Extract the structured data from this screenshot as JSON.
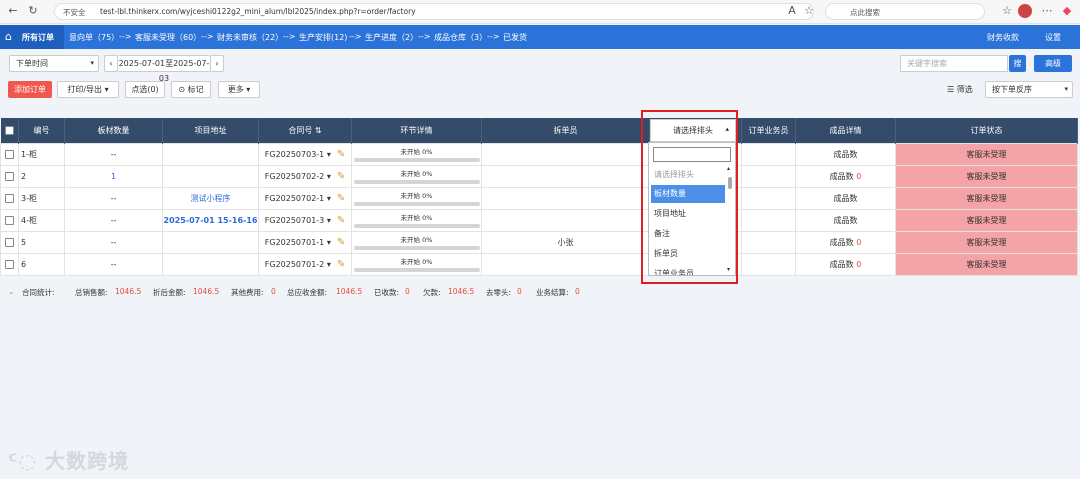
{
  "browser": {
    "insecure_label": "不安全",
    "url": "test-lbl.thinkerx.com/wyjceshi0122g2_mini_alum/lbl2025/index.php?r=order/factory",
    "search_placeholder": "点此搜索"
  },
  "nav": {
    "home_label": "所有订单",
    "tabs": [
      {
        "label": "意向单（75）"
      },
      {
        "label": "客服未受理（60）"
      },
      {
        "label": "财务未审核（22）"
      },
      {
        "label": "生产安排(12)"
      },
      {
        "label": "生产进度（2）"
      },
      {
        "label": "成品仓库（3）"
      },
      {
        "label": "已发货"
      }
    ],
    "arrow": "-->",
    "right": [
      "财务收款",
      "设置"
    ]
  },
  "filters": {
    "time_select": "下单时间",
    "date_range": "2025-07-01至2025-07-03",
    "keyword_placeholder": "关键字搜索",
    "search_button": "搜",
    "advanced_button": "高级"
  },
  "actions": {
    "add_order": "添加订单",
    "print_export": "打印/导出",
    "select": "点选(0)",
    "mark": "标记",
    "more": "更多",
    "filter": "筛选",
    "sort_select": "按下单反序"
  },
  "table": {
    "headers": [
      "编号",
      "板材数量",
      "项目地址",
      "合同号",
      "环节详情",
      "拆单员",
      "请选择排头",
      "订单业务员",
      "成品详情",
      "订单状态"
    ],
    "rows": [
      {
        "id": "1-柜",
        "qty": "--",
        "address": "",
        "contract": "FG20250703-1",
        "progress": "未开始 0%",
        "splitter": "",
        "product": "成品数",
        "product_count": "",
        "status": "客服未受理"
      },
      {
        "id": "2",
        "qty": "1",
        "address": "",
        "contract": "FG20250702-2",
        "progress": "未开始 0%",
        "splitter": "",
        "product": "成品数",
        "product_count": "0",
        "status": "客服未受理"
      },
      {
        "id": "3-柜",
        "qty": "--",
        "address": "测试小程序",
        "contract": "FG20250702-1",
        "progress": "未开始 0%",
        "splitter": "",
        "product": "成品数",
        "product_count": "",
        "status": "客服未受理"
      },
      {
        "id": "4-柜",
        "qty": "--",
        "address": "2025-07-01 15-16-16",
        "contract": "FG20250701-3",
        "progress": "未开始 0%",
        "splitter": "",
        "product": "成品数",
        "product_count": "",
        "status": "客服未受理"
      },
      {
        "id": "5",
        "qty": "--",
        "address": "",
        "contract": "FG20250701-1",
        "progress": "未开始 0%",
        "splitter": "小张",
        "product": "成品数",
        "product_count": "0",
        "status": "客服未受理"
      },
      {
        "id": "6",
        "qty": "--",
        "address": "",
        "contract": "FG20250701-2",
        "progress": "未开始 0%",
        "splitter": "",
        "product": "成品数",
        "product_count": "0",
        "status": "客服未受理"
      }
    ]
  },
  "dropdown": {
    "header": "请选择排头",
    "items": [
      {
        "label": "请选择排头",
        "state": "placeholder"
      },
      {
        "label": "板材数量",
        "state": "highlighted"
      },
      {
        "label": "项目地址",
        "state": "normal"
      },
      {
        "label": "备注",
        "state": "normal"
      },
      {
        "label": "拆单员",
        "state": "normal"
      },
      {
        "label": "订单业务员",
        "state": "normal"
      }
    ]
  },
  "summary": {
    "title": "合同统计:",
    "sales_label": "总销售额:",
    "sales_value": "1046.5",
    "discount_label": "折后金额:",
    "discount_value": "1046.5",
    "other_label": "其他费用:",
    "other_value": "0",
    "receivable_label": "总应收金额:",
    "receivable_value": "1046.5",
    "received_label": "已收款:",
    "received_value": "0",
    "owed_label": "欠款:",
    "owed_value": "1046.5",
    "rounding_label": "去零头:",
    "rounding_value": "0",
    "settle_label": "业务结算:",
    "settle_value": "0"
  },
  "watermark": "大数跨境",
  "colors": {
    "nav_blue": "#2b73d8",
    "header_dark": "#344b6a",
    "status_pink": "#f4a3a6",
    "highlight_red": "#e02020"
  }
}
